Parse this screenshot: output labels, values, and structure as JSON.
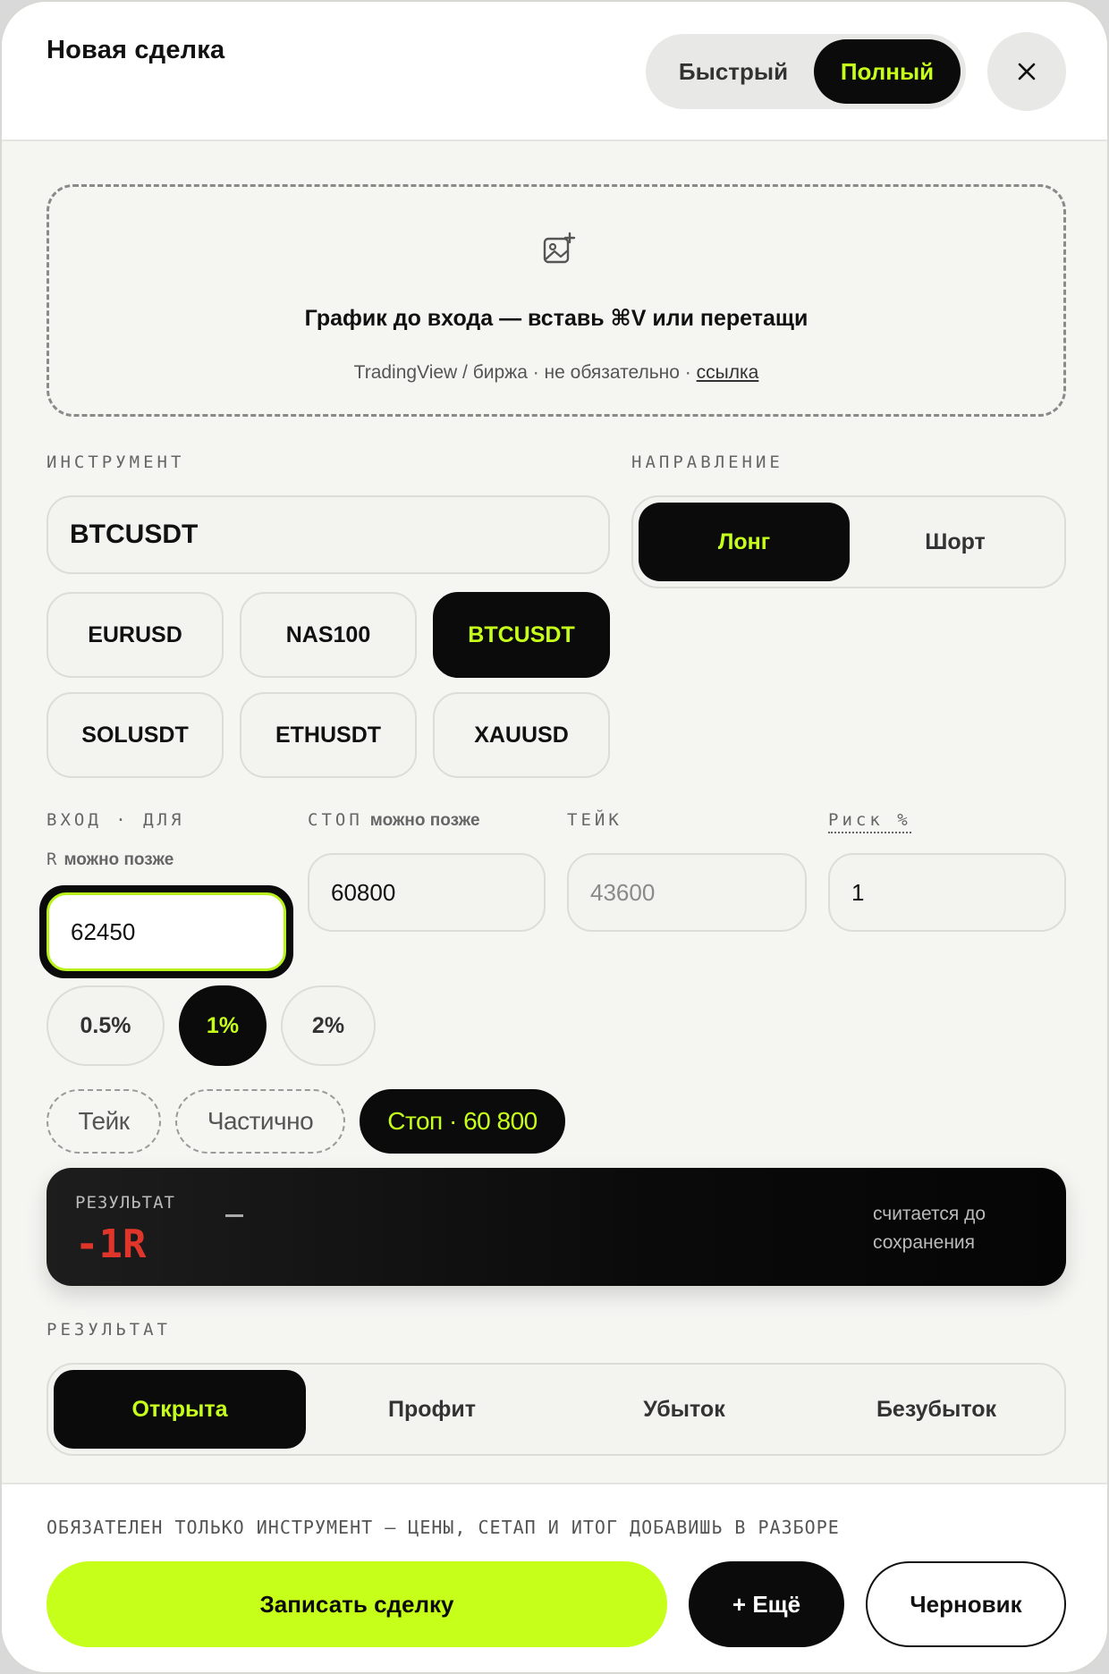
{
  "header": {
    "title": "Новая сделка",
    "mode_fast": "Быстрый",
    "mode_full": "Полный",
    "close_icon": "close-icon"
  },
  "dropzone": {
    "icon": "image-add-icon",
    "title": "График до входа — вставь ⌘V или перетащи",
    "subtitle": "TradingView / биржа · не обязательно ·",
    "link": "ссылка"
  },
  "instrument": {
    "label": "ИНСТРУМЕНТ",
    "value": "BTCUSDT",
    "chips": [
      "EURUSD",
      "NAS100",
      "BTCUSDT",
      "SOLUSDT",
      "ETHUSDT",
      "XAUUSD"
    ],
    "selected": "BTCUSDT"
  },
  "direction": {
    "label": "НАПРАВЛЕНИЕ",
    "long": "Лонг",
    "short": "Шорт",
    "selected": "Лонг"
  },
  "prices": {
    "entry_label": "ВХОД · ДЛЯ",
    "entry_label2": "R",
    "entry_hint": "можно позже",
    "entry_value": "62450",
    "stop_label": "СТОП",
    "stop_hint": "можно позже",
    "stop_value": "60800",
    "take_label": "ТЕЙК",
    "take_placeholder": "43600",
    "risk_label": "Риск %",
    "risk_value": "1"
  },
  "risk_presets": {
    "options": [
      "0.5%",
      "1%",
      "2%"
    ],
    "selected": "1%"
  },
  "exit_tags": {
    "take": "Тейк",
    "partial": "Частично",
    "stop": "Стоп · 60 800",
    "selected": "stop"
  },
  "result_card": {
    "label": "РЕЗУЛЬТАТ",
    "value": "-1R",
    "note": "считается до сохранения"
  },
  "outcome": {
    "label": "РЕЗУЛЬТАТ",
    "options": [
      "Открыта",
      "Профит",
      "Убыток",
      "Безубыток"
    ],
    "selected": "Открыта"
  },
  "footer": {
    "hint": "ОБЯЗАТЕЛЕН ТОЛЬКО ИНСТРУМЕНТ — ЦЕНЫ, СЕТАП И ИТОГ ДОБАВИШЬ В РАЗБОРЕ",
    "submit": "Записать сделку",
    "more": "+ Ещё",
    "draft": "Черновик"
  },
  "colors": {
    "accent": "#c6ff1a",
    "dark": "#0b0b0b",
    "loss": "#e0352b"
  }
}
